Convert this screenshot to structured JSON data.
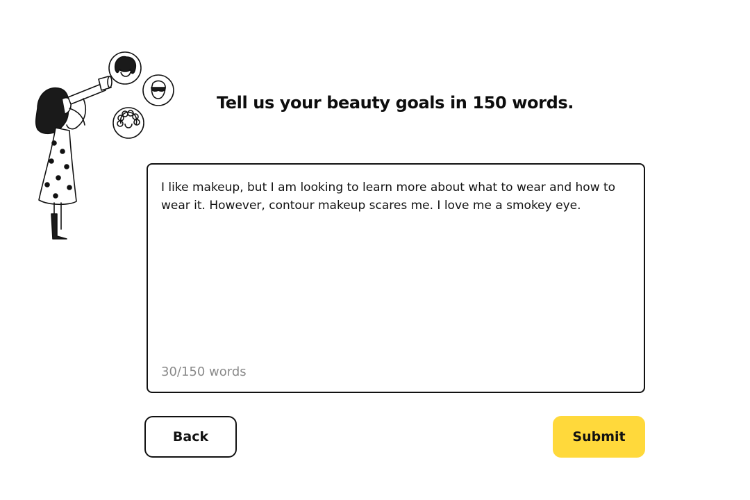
{
  "page": {
    "title": "Tell us your beauty goals in 150 words."
  },
  "goals": {
    "text": "I like makeup, but I am looking to learn more about what to wear and how to wear it. However, contour makeup scares me. I love me a smokey eye.",
    "word_count_label": "30/150 words"
  },
  "actions": {
    "back_label": "Back",
    "submit_label": "Submit"
  },
  "illustration": {
    "icons": [
      "woman-with-telescope-icon",
      "short-hair-face-icon",
      "sleeping-mask-face-icon",
      "curly-hair-face-icon"
    ]
  },
  "colors": {
    "accent": "#ffd93b",
    "text": "#111111",
    "muted": "#8a8a8a",
    "border": "#111111"
  }
}
